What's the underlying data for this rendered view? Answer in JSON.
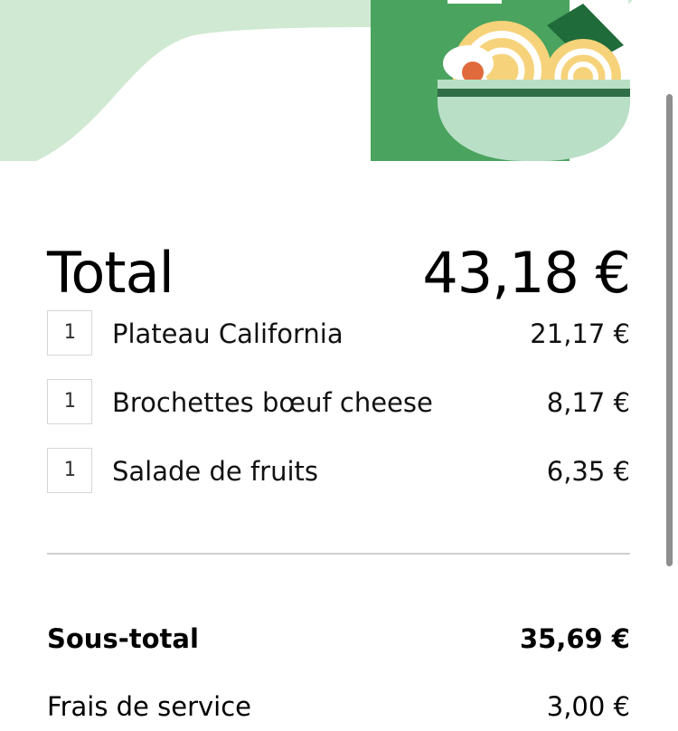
{
  "order": {
    "total_label": "Total",
    "total_value": "43,18 €",
    "items": [
      {
        "qty": "1",
        "name": "Plateau California",
        "price": "21,17 €"
      },
      {
        "qty": "1",
        "name": "Brochettes bœuf cheese",
        "price": "8,17 €"
      },
      {
        "qty": "1",
        "name": "Salade de fruits",
        "price": "6,35 €"
      }
    ]
  },
  "summary": {
    "subtotal_label": "Sous-total",
    "subtotal_value": "35,69 €",
    "service_fee_label": "Frais de service",
    "service_fee_value": "3,00 €"
  },
  "illustration": {
    "icon": "noodle-bowl-icon",
    "colors": {
      "mint": "#cfe9d2",
      "green": "#4aa35e",
      "dark_green": "#1f6b3a",
      "bowl": "#b9dfc7",
      "noodles": "#f6d37a",
      "egg": "#e06a3c"
    }
  }
}
